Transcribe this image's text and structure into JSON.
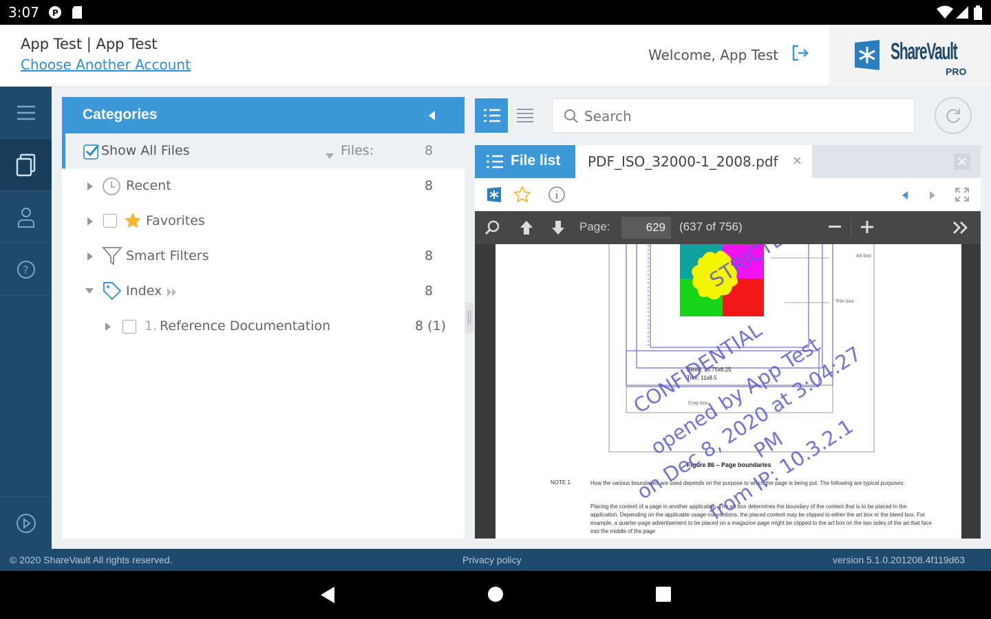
{
  "status_bar": {
    "time": "3:07"
  },
  "header": {
    "account": "App Test | App Test",
    "choose_account": "Choose Another Account",
    "welcome": "Welcome, App Test",
    "logo_main": "ShareVault",
    "logo_sub": "PRO"
  },
  "categories": {
    "title": "Categories",
    "show_all": "Show All Files",
    "files_label": "Files:",
    "files_count": "8",
    "items": [
      {
        "label": "Recent",
        "count": "8"
      },
      {
        "label": "Favorites",
        "count": ""
      },
      {
        "label": "Smart Filters",
        "count": "8"
      },
      {
        "label": "Index",
        "count": "8"
      }
    ],
    "sub_item": {
      "number": "1.",
      "label": "Reference Documentation",
      "count": "8 (1)"
    }
  },
  "search": {
    "placeholder": "Search"
  },
  "tabs": {
    "file_list": "File list",
    "document": "PDF_ISO_32000-1_2008.pdf",
    "close": "×"
  },
  "pdf_toolbar": {
    "page_label": "Page:",
    "page_value": "629",
    "page_of": "(637 of 756)"
  },
  "pdf_page": {
    "figure_caption": "Figure 86 – Page boundaries",
    "note_label": "NOTE 1",
    "note_text": "How the various boundaries are used depends on the purpose to which the page is being put. The following are typical purposes:",
    "para_text": "Placing the content of a page in another application. The art box determines the boundary of the content that is to be placed in the application. Depending on the applicable usage conventions, the placed content may be clipped to either the art box or the bleed box. For example, a quarter-page advertisement to be placed on a magazine page might be clipped to the art box on the two sides of the ad that face into the middle of the page",
    "diagram_labels": [
      "Art box",
      "Trim box",
      "Bleed: 10.75x8.25",
      "Trim: 11x8.5",
      "Crop box"
    ],
    "watermark": [
      "STRICTLY",
      "CONFIDENTIAL",
      "opened by App Test",
      "on Dec 8, 2020 at 3:04:27",
      "PM",
      "from IP: 10.3.2.1"
    ]
  },
  "footer": {
    "copyright": "© 2020 ShareVault All rights reserved.",
    "privacy": "Privacy policy",
    "version": "version 5.1.0.201208.4f119d63"
  },
  "colors": {
    "accent": "#3d97d8",
    "rail": "#1e4a6d",
    "watermark": "#5b5bd6"
  }
}
